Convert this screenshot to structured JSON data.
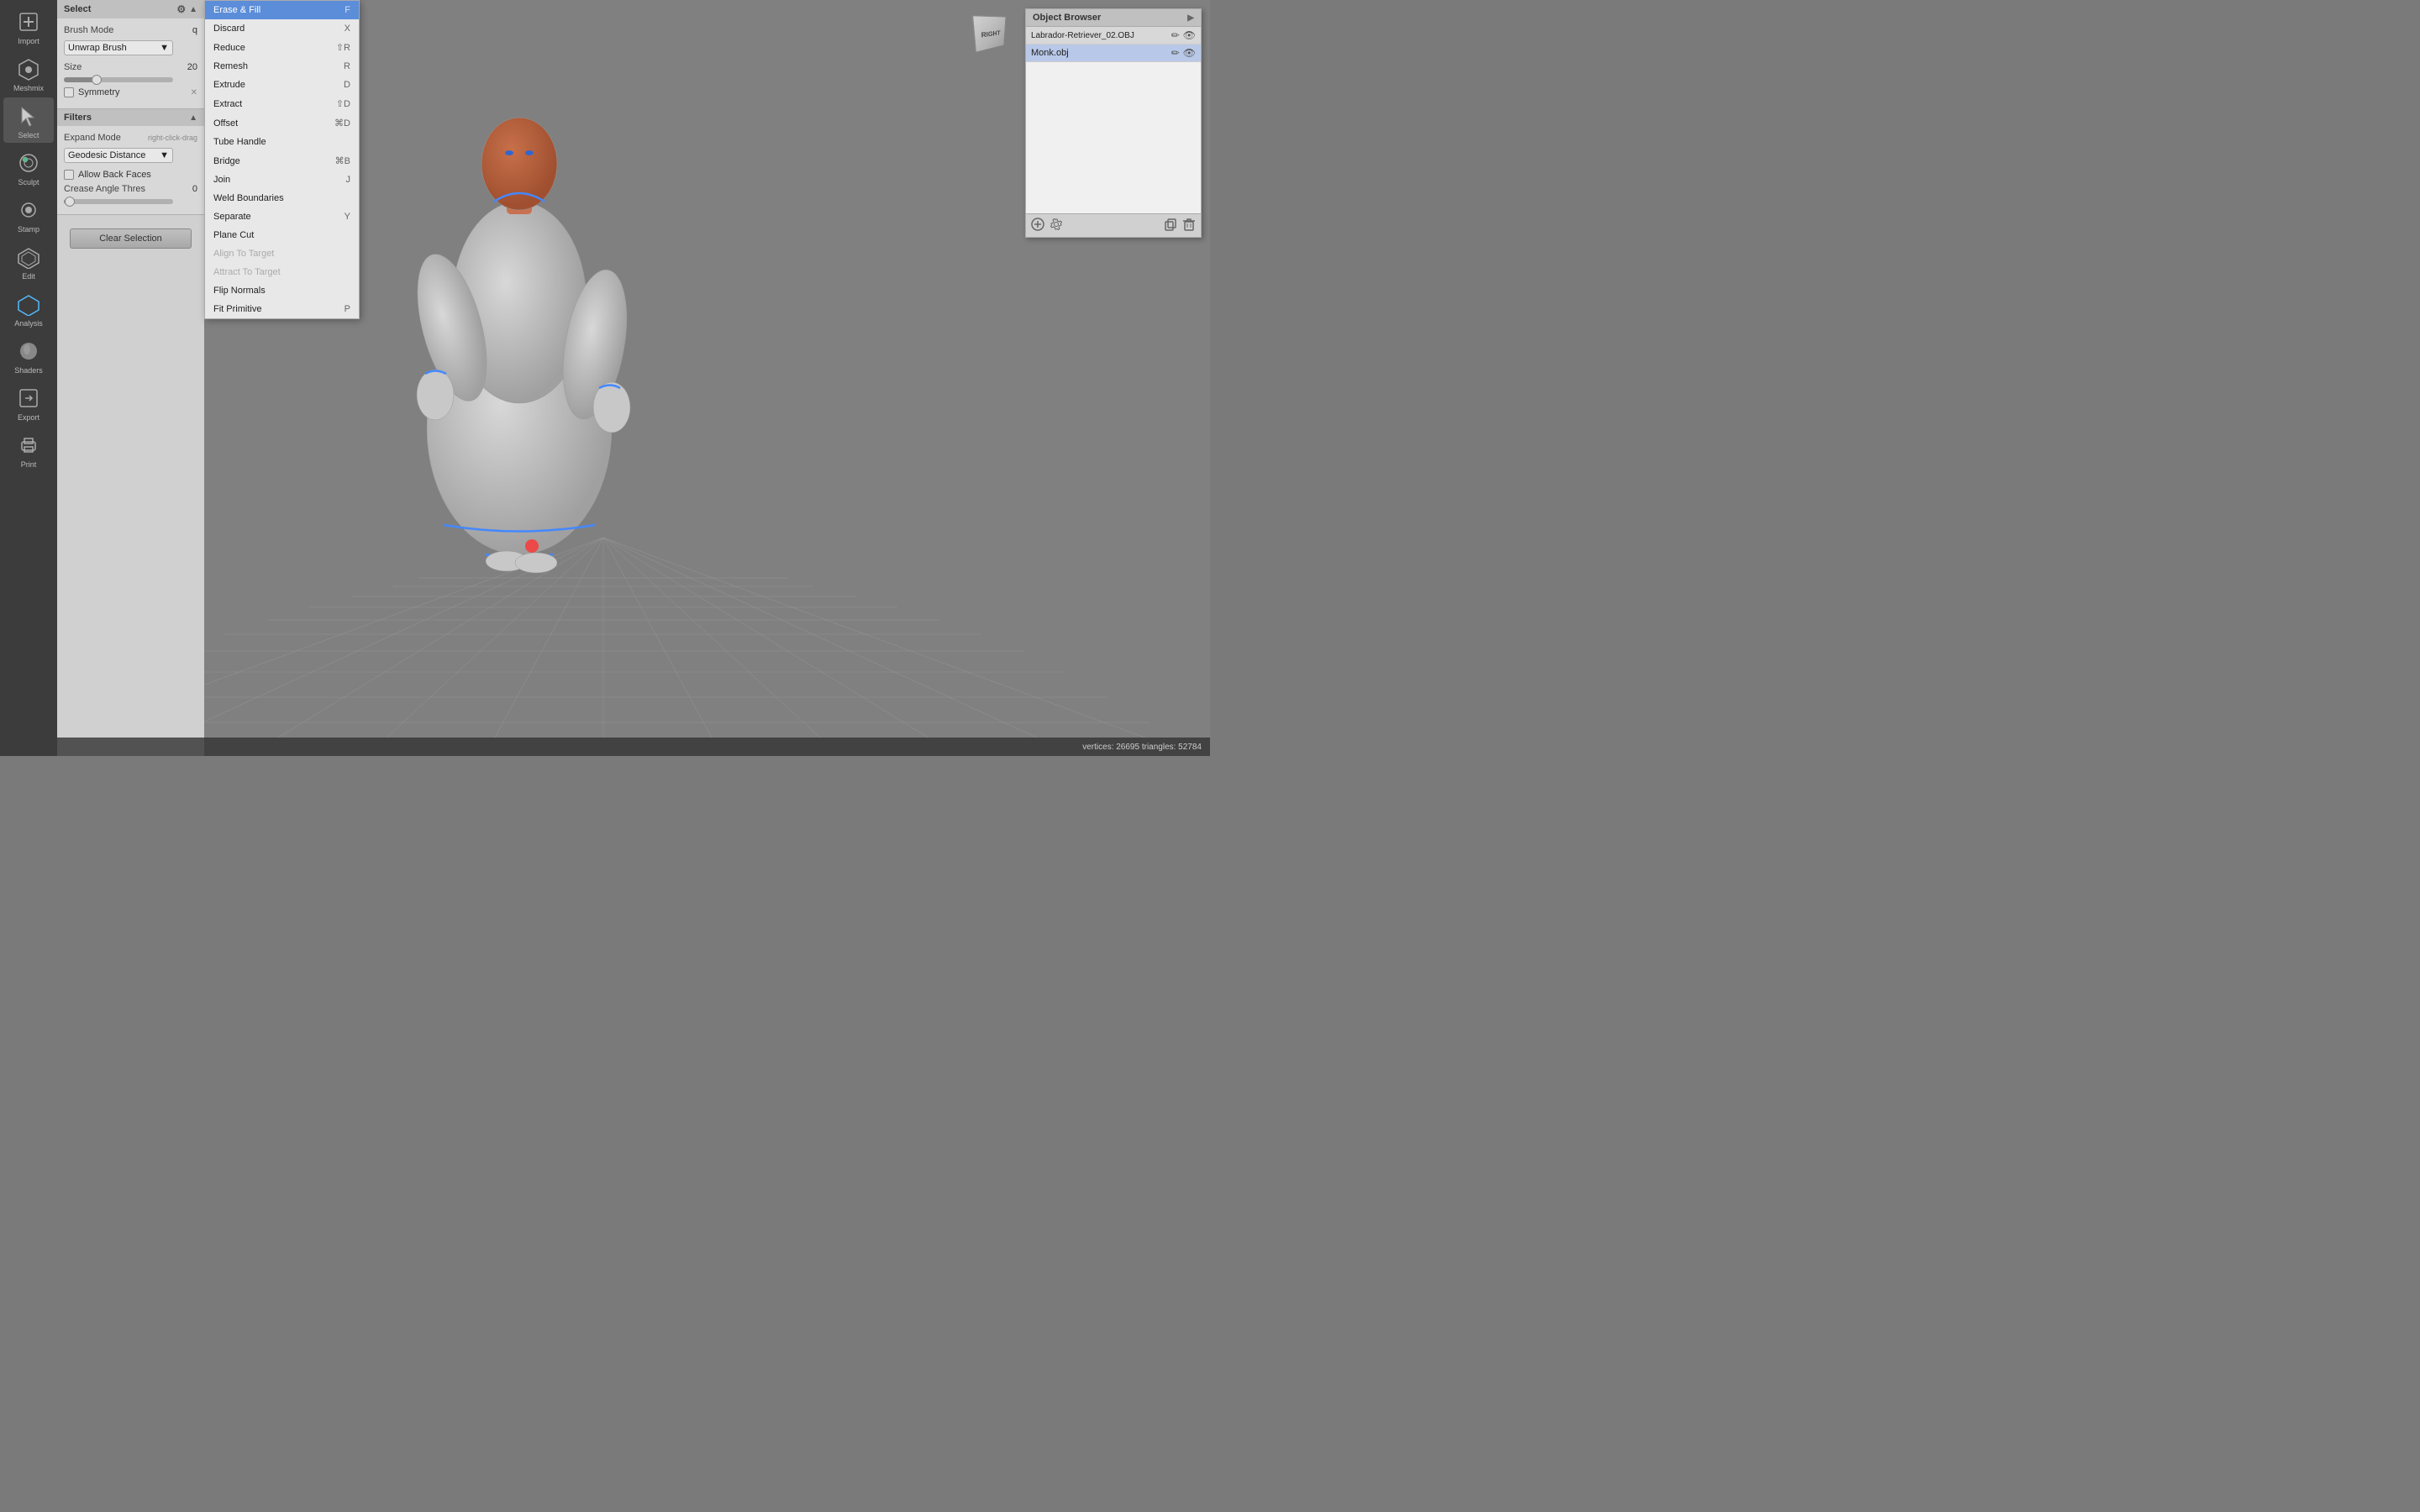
{
  "app": {
    "title": "Meshmix"
  },
  "left_toolbar": {
    "items": [
      {
        "id": "import",
        "label": "Import",
        "icon": "+"
      },
      {
        "id": "meshmix",
        "label": "Meshmix",
        "icon": "⬡"
      },
      {
        "id": "sculpt",
        "label": "Sculpt",
        "icon": "✏"
      },
      {
        "id": "stamp",
        "label": "Stamp",
        "icon": "◉"
      },
      {
        "id": "edit",
        "label": "Edit",
        "icon": "⬡"
      },
      {
        "id": "analysis",
        "label": "Analysis",
        "icon": "⬡"
      },
      {
        "id": "shaders",
        "label": "Shaders",
        "icon": "●"
      },
      {
        "id": "export",
        "label": "Export",
        "icon": "↗"
      },
      {
        "id": "print",
        "label": "Print",
        "icon": "🖨"
      }
    ],
    "active": "select"
  },
  "select_panel": {
    "title": "Select",
    "brush_mode_label": "Brush Mode",
    "brush_mode_value": "Unwrap Brush",
    "size_label": "Size",
    "size_value": "20",
    "size_slider_pct": 30,
    "symmetry_label": "Symmetry",
    "symmetry_checked": false,
    "filters_title": "Filters",
    "expand_mode_label": "Expand Mode",
    "expand_mode_hint": "right-click-drag",
    "expand_mode_value": "Geodesic Distance",
    "allow_back_faces_label": "Allow Back Faces",
    "allow_back_faces_checked": false,
    "crease_angle_label": "Crease Angle Thres",
    "crease_angle_value": "0",
    "crease_slider_pct": 5,
    "clear_selection_label": "Clear Selection"
  },
  "dropdown_menu": {
    "items": [
      {
        "label": "Erase & Fill",
        "shortcut": "F",
        "highlighted": true,
        "disabled": false
      },
      {
        "label": "Discard",
        "shortcut": "X",
        "highlighted": false,
        "disabled": false
      },
      {
        "label": "Reduce",
        "shortcut": "⇧R",
        "highlighted": false,
        "disabled": false
      },
      {
        "label": "Remesh",
        "shortcut": "R",
        "highlighted": false,
        "disabled": false
      },
      {
        "label": "Extrude",
        "shortcut": "D",
        "highlighted": false,
        "disabled": false
      },
      {
        "label": "Extract",
        "shortcut": "⇧D",
        "highlighted": false,
        "disabled": false
      },
      {
        "label": "Offset",
        "shortcut": "⌘D",
        "highlighted": false,
        "disabled": false
      },
      {
        "label": "Tube Handle",
        "shortcut": "",
        "highlighted": false,
        "disabled": false
      },
      {
        "label": "Bridge",
        "shortcut": "⌘B",
        "highlighted": false,
        "disabled": false
      },
      {
        "label": "Join",
        "shortcut": "J",
        "highlighted": false,
        "disabled": false
      },
      {
        "label": "Weld Boundaries",
        "shortcut": "",
        "highlighted": false,
        "disabled": false
      },
      {
        "label": "Separate",
        "shortcut": "Y",
        "highlighted": false,
        "disabled": false
      },
      {
        "label": "Plane Cut",
        "shortcut": "",
        "highlighted": false,
        "disabled": false
      },
      {
        "label": "Align To Target",
        "shortcut": "",
        "highlighted": false,
        "disabled": true
      },
      {
        "label": "Attract To Target",
        "shortcut": "",
        "highlighted": false,
        "disabled": true
      },
      {
        "label": "Flip Normals",
        "shortcut": "",
        "highlighted": false,
        "disabled": false
      },
      {
        "label": "Fit Primitive",
        "shortcut": "P",
        "highlighted": false,
        "disabled": false
      }
    ]
  },
  "object_browser": {
    "title": "Object Browser",
    "items": [
      {
        "name": "Labrador-Retriever_02.OBJ",
        "selected": false,
        "edit_icon": "✏",
        "eye_icon": "👁"
      },
      {
        "name": "Monk.obj",
        "selected": true,
        "edit_icon": "✏",
        "eye_icon": "👁"
      }
    ]
  },
  "status_bar": {
    "text": "vertices: 26695  triangles: 52784"
  },
  "viewport": {
    "grid_color": "#909090"
  }
}
